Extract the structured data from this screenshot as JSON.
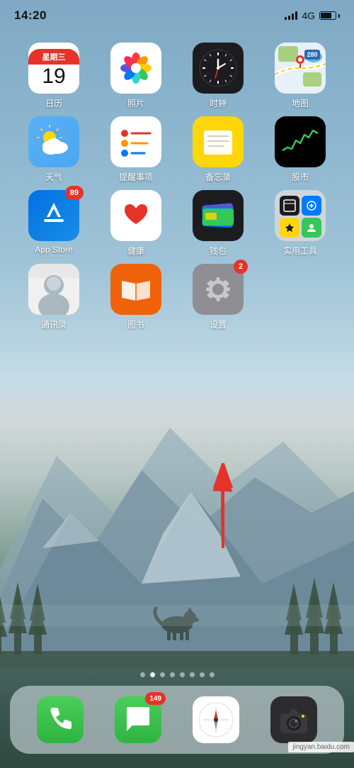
{
  "status": {
    "time": "14:20",
    "network": "4G"
  },
  "apps": {
    "row1": [
      {
        "id": "calendar",
        "label": "日历",
        "type": "calendar",
        "date": "19",
        "weekday": "星期三",
        "badge": null
      },
      {
        "id": "photos",
        "label": "照片",
        "type": "photos",
        "badge": null
      },
      {
        "id": "clock",
        "label": "时钟",
        "type": "clock",
        "badge": null
      },
      {
        "id": "maps",
        "label": "地图",
        "type": "maps",
        "badge": null
      }
    ],
    "row2": [
      {
        "id": "weather",
        "label": "天气",
        "type": "weather",
        "badge": null
      },
      {
        "id": "reminders",
        "label": "提醒事项",
        "type": "reminders",
        "badge": null
      },
      {
        "id": "notes",
        "label": "备忘录",
        "type": "notes",
        "badge": null
      },
      {
        "id": "stocks",
        "label": "股市",
        "type": "stocks",
        "badge": null
      }
    ],
    "row3": [
      {
        "id": "appstore",
        "label": "App Store",
        "type": "appstore",
        "badge": "89"
      },
      {
        "id": "health",
        "label": "健康",
        "type": "health",
        "badge": null
      },
      {
        "id": "wallet",
        "label": "钱包",
        "type": "wallet",
        "badge": null
      },
      {
        "id": "utilities",
        "label": "实用工具",
        "type": "utilities",
        "badge": null
      }
    ],
    "row4": [
      {
        "id": "contacts",
        "label": "通讯录",
        "type": "contacts",
        "badge": null
      },
      {
        "id": "books",
        "label": "图书",
        "type": "books",
        "badge": null
      },
      {
        "id": "settings",
        "label": "设置",
        "type": "settings",
        "badge": "2"
      },
      {
        "id": "empty",
        "label": "",
        "type": "empty",
        "badge": null
      }
    ]
  },
  "dock": [
    {
      "id": "phone",
      "label": "电话",
      "type": "phone",
      "badge": null
    },
    {
      "id": "messages",
      "label": "信息",
      "type": "messages",
      "badge": "149"
    },
    {
      "id": "safari",
      "label": "Safari",
      "type": "safari",
      "badge": null
    },
    {
      "id": "camera",
      "label": "相机",
      "type": "camera",
      "badge": null
    }
  ],
  "pageDots": [
    1,
    2,
    3,
    4,
    5,
    6,
    7,
    8
  ],
  "activePageDot": 1,
  "watermark": "jingyan.baidu.com"
}
